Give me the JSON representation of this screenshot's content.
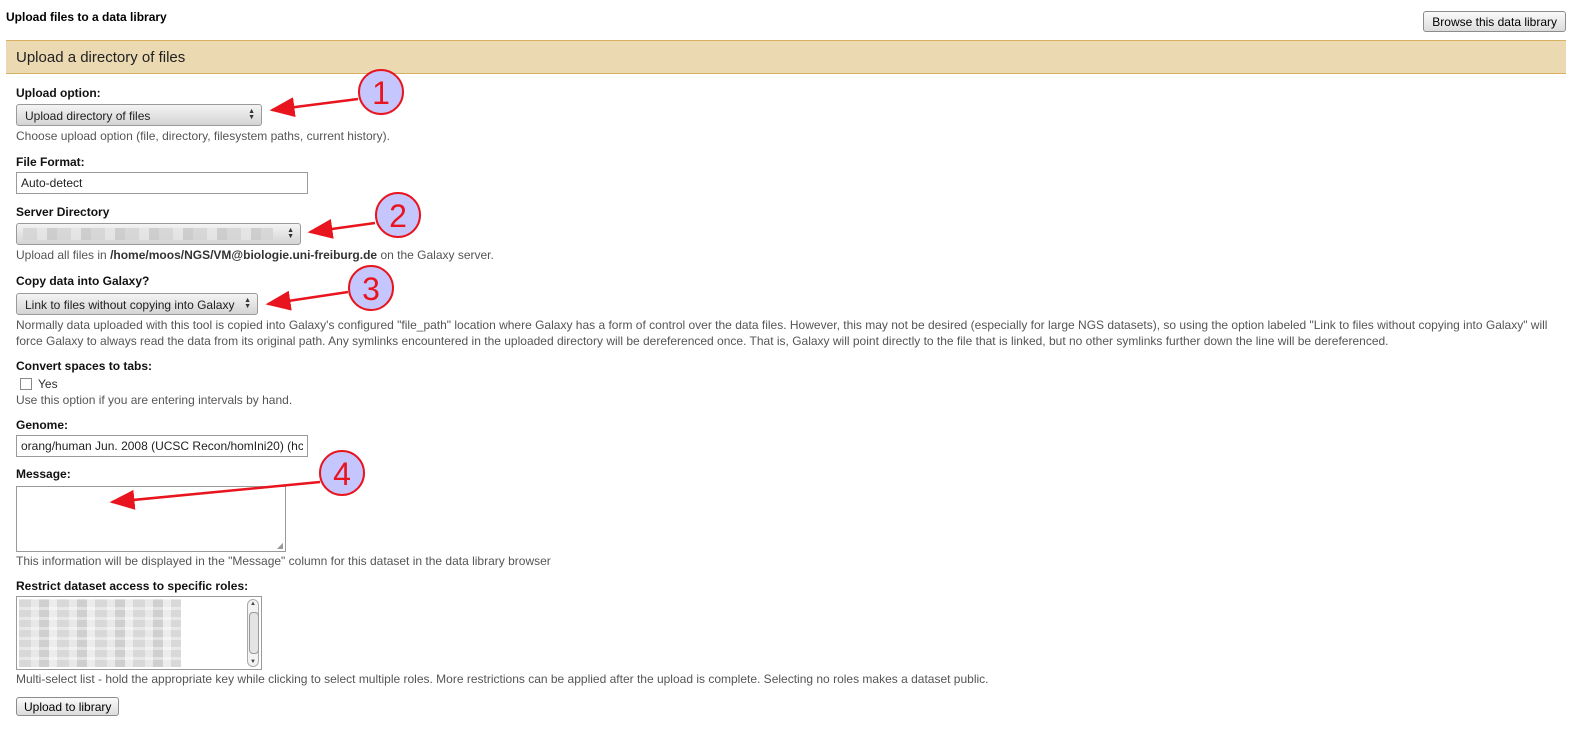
{
  "header": {
    "title": "Upload files to a data library",
    "browse_button": "Browse this data library"
  },
  "panel": {
    "title": "Upload a directory of files"
  },
  "upload_option": {
    "label": "Upload option:",
    "selected": "Upload directory of files",
    "help": "Choose upload option (file, directory, filesystem paths, current history)."
  },
  "file_format": {
    "label": "File Format:",
    "value": "Auto-detect"
  },
  "server_directory": {
    "label": "Server Directory",
    "help_prefix": "Upload all files in ",
    "path": "/home/moos/NGS/VM@biologie.uni-freiburg.de",
    "help_suffix": " on the Galaxy server."
  },
  "copy_data": {
    "label": "Copy data into Galaxy?",
    "selected": "Link to files without copying into Galaxy",
    "help": "Normally data uploaded with this tool is copied into Galaxy's configured \"file_path\" location where Galaxy has a form of control over the data files. However, this may not be desired (especially for large NGS datasets), so using the option labeled \"Link to files without copying into Galaxy\" will force Galaxy to always read the data from its original path. Any symlinks encountered in the uploaded directory will be dereferenced once. That is, Galaxy will point directly to the file that is linked, but no other symlinks further down the line will be dereferenced."
  },
  "convert_spaces": {
    "label": "Convert spaces to tabs:",
    "checkbox_label": "Yes",
    "help": "Use this option if you are entering intervals by hand."
  },
  "genome": {
    "label": "Genome:",
    "value": "orang/human Jun. 2008 (UCSC Recon/homIni20) (hc"
  },
  "message": {
    "label": "Message:",
    "value": "",
    "help": "This information will be displayed in the \"Message\" column for this dataset in the data library browser"
  },
  "roles": {
    "label": "Restrict dataset access to specific roles:",
    "help": "Multi-select list - hold the appropriate key while clicking to select multiple roles. More restrictions can be applied after the upload is complete. Selecting no roles makes a dataset public."
  },
  "submit": {
    "label": "Upload to library"
  },
  "annotations": {
    "marker_1": "1",
    "marker_2": "2",
    "marker_3": "3",
    "marker_4": "4"
  },
  "colors": {
    "panel_bg": "#ebd9b2",
    "panel_border": "#d6b161",
    "arrow": "#e8141e",
    "marker_fill": "#c6c6ff"
  }
}
